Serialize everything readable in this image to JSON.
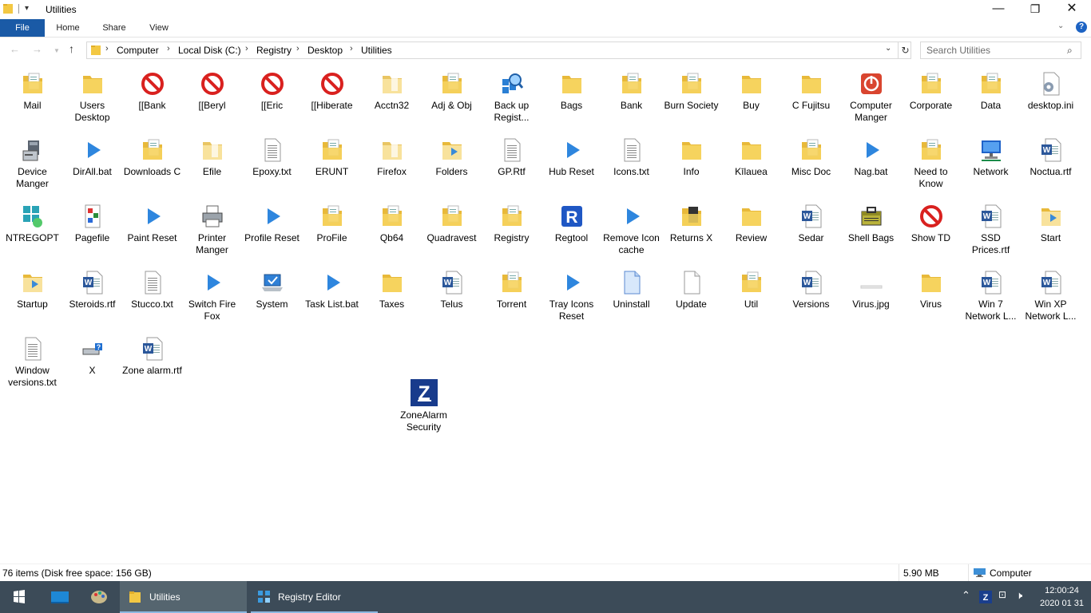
{
  "window": {
    "title": "Utilities"
  },
  "ribbon": {
    "tabs": [
      "File",
      "Home",
      "Share",
      "View"
    ]
  },
  "breadcrumb": [
    "Computer",
    "Local Disk (C:)",
    "Registry",
    "Desktop",
    "Utilities"
  ],
  "search": {
    "placeholder": "Search Utilities"
  },
  "items": [
    {
      "label": "Mail",
      "icon": "folder-doc"
    },
    {
      "label": "Users Desktop",
      "icon": "folder"
    },
    {
      "label": "[[Bank",
      "icon": "prohibited"
    },
    {
      "label": "[[Beryl",
      "icon": "prohibited"
    },
    {
      "label": "[[Eric",
      "icon": "prohibited"
    },
    {
      "label": "[[Hiberate",
      "icon": "prohibited"
    },
    {
      "label": "Acctn32",
      "icon": "folder-light"
    },
    {
      "label": "Adj & Obj",
      "icon": "folder-doc"
    },
    {
      "label": "Back up Regist...",
      "icon": "registry-backup"
    },
    {
      "label": "Bags",
      "icon": "folder"
    },
    {
      "label": "Bank",
      "icon": "folder-doc"
    },
    {
      "label": "Burn Society",
      "icon": "folder-doc"
    },
    {
      "label": "Buy",
      "icon": "folder"
    },
    {
      "label": "C Fujitsu",
      "icon": "folder"
    },
    {
      "label": "Computer Manger",
      "icon": "power"
    },
    {
      "label": "Corporate",
      "icon": "folder-doc"
    },
    {
      "label": "Data",
      "icon": "folder-doc"
    },
    {
      "label": "desktop.ini",
      "icon": "settings-file"
    },
    {
      "label": "Device Manger",
      "icon": "device"
    },
    {
      "label": "DirAll.bat",
      "icon": "play"
    },
    {
      "label": "Downloads C",
      "icon": "folder-doc"
    },
    {
      "label": "Efile",
      "icon": "folder-light"
    },
    {
      "label": "Epoxy.txt",
      "icon": "text-file"
    },
    {
      "label": "ERUNT",
      "icon": "folder-doc"
    },
    {
      "label": "Firefox",
      "icon": "folder-light"
    },
    {
      "label": "Folders",
      "icon": "folder-play"
    },
    {
      "label": "GP.Rtf",
      "icon": "text-file"
    },
    {
      "label": "Hub Reset",
      "icon": "play"
    },
    {
      "label": "Icons.txt",
      "icon": "text-file"
    },
    {
      "label": "Info",
      "icon": "folder"
    },
    {
      "label": "Kīlauea",
      "icon": "folder"
    },
    {
      "label": "Misc Doc",
      "icon": "folder-doc"
    },
    {
      "label": "Nag.bat",
      "icon": "play"
    },
    {
      "label": "Need to Know",
      "icon": "folder-doc"
    },
    {
      "label": "Network",
      "icon": "network"
    },
    {
      "label": "Noctua.rtf",
      "icon": "word"
    },
    {
      "label": "NTREGOPT",
      "icon": "ntregopt"
    },
    {
      "label": "Pagefile",
      "icon": "pagefile"
    },
    {
      "label": "Paint Reset",
      "icon": "play"
    },
    {
      "label": "Printer Manger",
      "icon": "printer"
    },
    {
      "label": "Profile Reset",
      "icon": "play"
    },
    {
      "label": "ProFile",
      "icon": "folder-doc"
    },
    {
      "label": "Qb64",
      "icon": "folder-doc"
    },
    {
      "label": "Quadravest",
      "icon": "folder-doc"
    },
    {
      "label": "Registry",
      "icon": "folder-doc"
    },
    {
      "label": "Regtool",
      "icon": "regtool"
    },
    {
      "label": "Remove Icon cache",
      "icon": "play"
    },
    {
      "label": "Returns X",
      "icon": "folder-dark"
    },
    {
      "label": "Review",
      "icon": "folder"
    },
    {
      "label": "Sedar",
      "icon": "word"
    },
    {
      "label": "Shell Bags",
      "icon": "shellbags"
    },
    {
      "label": "Show TD",
      "icon": "prohibited"
    },
    {
      "label": "SSD Prices.rtf",
      "icon": "word"
    },
    {
      "label": "Start",
      "icon": "folder-play"
    },
    {
      "label": "Startup",
      "icon": "folder-play"
    },
    {
      "label": "Steroids.rtf",
      "icon": "word"
    },
    {
      "label": "Stucco.txt",
      "icon": "text-file"
    },
    {
      "label": "Switch Fire Fox",
      "icon": "play"
    },
    {
      "label": "System",
      "icon": "system"
    },
    {
      "label": "Task List.bat",
      "icon": "play"
    },
    {
      "label": "Taxes",
      "icon": "folder"
    },
    {
      "label": "Telus",
      "icon": "word"
    },
    {
      "label": "Torrent",
      "icon": "folder-doc"
    },
    {
      "label": "Tray Icons Reset",
      "icon": "play"
    },
    {
      "label": "Uninstall",
      "icon": "blue-file"
    },
    {
      "label": "Update",
      "icon": "blank-file"
    },
    {
      "label": "Util",
      "icon": "folder-doc"
    },
    {
      "label": "Versions",
      "icon": "word"
    },
    {
      "label": "Virus.jpg",
      "icon": "image-thin"
    },
    {
      "label": "Virus",
      "icon": "folder"
    },
    {
      "label": "Win 7 Network L...",
      "icon": "word"
    },
    {
      "label": "Win XP Network L...",
      "icon": "word"
    },
    {
      "label": "Window versions.txt",
      "icon": "text-file"
    },
    {
      "label": "X",
      "icon": "usb-drive"
    },
    {
      "label": "Zone alarm.rtf",
      "icon": "word"
    },
    {
      "label": "ZoneAlarm Security",
      "icon": "zonealarm"
    }
  ],
  "status": {
    "count": "76 items (Disk free space: 156 GB)",
    "size": "5.90 MB",
    "location": "Computer"
  },
  "taskbar": {
    "apps": [
      {
        "label": "Utilities",
        "icon": "folder-icon",
        "active": true
      },
      {
        "label": "Registry Editor",
        "icon": "registry-icon",
        "active": false
      }
    ],
    "time": "12:00:24",
    "date": "2020 01 31"
  }
}
